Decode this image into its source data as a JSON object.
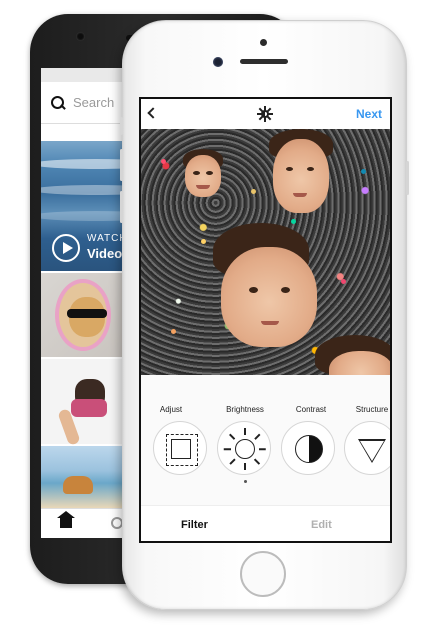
{
  "back_phone": {
    "search_placeholder": "Search",
    "video_tile": {
      "watch_label": "WATCH",
      "title": "Video"
    },
    "tabbar": {
      "icons": [
        "home-icon",
        "search-icon"
      ]
    }
  },
  "editor": {
    "topbar": {
      "back_icon": "chevron-left-icon",
      "lux_icon": "lux-icon",
      "next_label": "Next"
    },
    "tools": [
      {
        "label": "Adjust",
        "icon": "adjust-icon"
      },
      {
        "label": "Brightness",
        "icon": "brightness-icon"
      },
      {
        "label": "Contrast",
        "icon": "contrast-icon"
      },
      {
        "label": "Structure",
        "icon": "structure-icon"
      }
    ],
    "selected_tool": "Brightness",
    "tabs": {
      "filter": "Filter",
      "edit": "Edit"
    },
    "active_tab": "Filter"
  },
  "colors": {
    "accent": "#3897f0",
    "inactive_tab": "#b0b0b0"
  }
}
